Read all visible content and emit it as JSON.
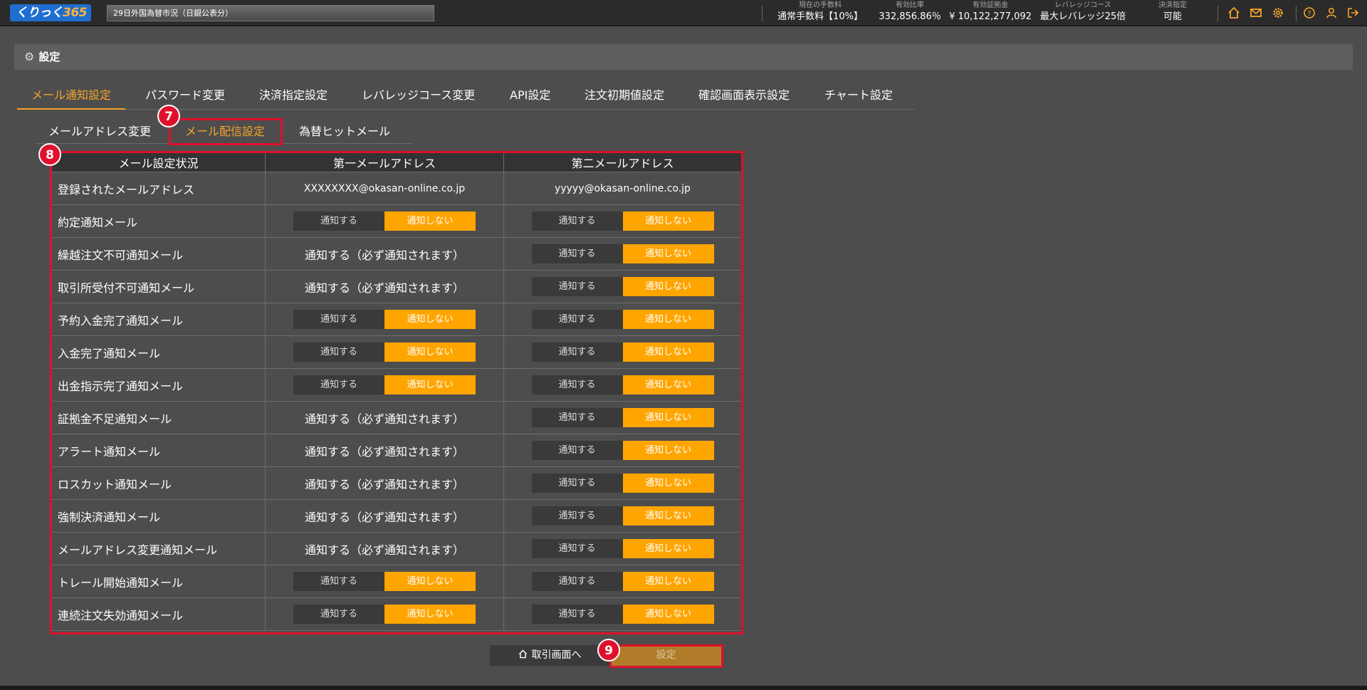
{
  "header": {
    "logo_text": "くりっく",
    "logo_num": "365",
    "ticker": "29日外国為替市況（日銀公表分）",
    "stats": [
      {
        "label": "現在の手数料",
        "value": "通常手数料【10%】"
      },
      {
        "label": "有効比率",
        "value": "332,856.86％"
      },
      {
        "label": "有効証拠金",
        "value": "¥ 10,122,277,092"
      },
      {
        "label": "レバレッジコース",
        "value": "最大レバレッジ25倍"
      },
      {
        "label": "決済指定",
        "value": "可能"
      }
    ],
    "icons": [
      "home-icon",
      "mail-icon",
      "gear-icon",
      "help-icon",
      "user-icon",
      "logout-icon"
    ],
    "accent_color": "#f3a52a"
  },
  "section": {
    "title": "設定"
  },
  "main_tabs": [
    "メール通知設定",
    "パスワード変更",
    "決済指定設定",
    "レバレッジコース変更",
    "API設定",
    "注文初期値設定",
    "確認画面表示設定",
    "チャート設定"
  ],
  "sub_tabs": [
    "メールアドレス変更",
    "メール配信設定",
    "為替ヒットメール"
  ],
  "annotations": {
    "b7": "7",
    "b8": "8",
    "b9": "9"
  },
  "table": {
    "headers": [
      "メール設定状況",
      "第一メールアドレス",
      "第二メールアドレス"
    ],
    "email_row": {
      "label": "登録されたメールアドレス",
      "email1": "XXXXXXXX@okasan-online.co.jp",
      "email2": "yyyyy@okasan-online.co.jp"
    },
    "toggle_on_label": "通知する",
    "toggle_off_label": "通知しない",
    "mandatory_text": "通知する（必ず通知されます）",
    "rows": [
      {
        "label": "約定通知メール"
      },
      {
        "label": "繰越注文不可通知メール"
      },
      {
        "label": "取引所受付不可通知メール"
      },
      {
        "label": "予約入金完了通知メール"
      },
      {
        "label": "入金完了通知メール"
      },
      {
        "label": "出金指示完了通知メール"
      },
      {
        "label": "証拠金不足通知メール"
      },
      {
        "label": "アラート通知メール"
      },
      {
        "label": "ロスカット通知メール"
      },
      {
        "label": "強制決済通知メール"
      },
      {
        "label": "メールアドレス変更通知メール"
      },
      {
        "label": "トレール開始通知メール"
      },
      {
        "label": "連続注文失効通知メール"
      }
    ]
  },
  "buttons": {
    "back": "取引画面へ",
    "set": "設定"
  }
}
